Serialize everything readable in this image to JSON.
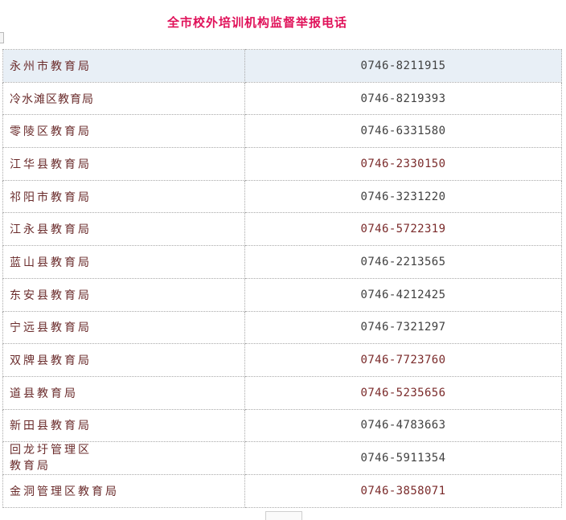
{
  "title": "全市校外培训机构监督举报电话",
  "rows": [
    {
      "unit": "永州市教育局",
      "phone": "0746-8211915"
    },
    {
      "unit": "冷水滩区教育局",
      "phone": "0746-8219393"
    },
    {
      "unit": "零陵区教育局",
      "phone": "0746-6331580"
    },
    {
      "unit": "江华县教育局",
      "phone": "0746-2330150"
    },
    {
      "unit": "祁阳市教育局",
      "phone": "0746-3231220"
    },
    {
      "unit": "江永县教育局",
      "phone": "0746-5722319"
    },
    {
      "unit": "蓝山县教育局",
      "phone": "0746-2213565"
    },
    {
      "unit": "东安县教育局",
      "phone": "0746-4212425"
    },
    {
      "unit": "宁远县教育局",
      "phone": "0746-7321297"
    },
    {
      "unit": "双牌县教育局",
      "phone": "0746-7723760"
    },
    {
      "unit": "道县教育局",
      "phone": "0746-5235656"
    },
    {
      "unit": "新田县教育局",
      "phone": "0746-4783663"
    },
    {
      "unit_line1": "回龙圩管理区",
      "unit_line2": "教育局",
      "phone": "0746-5911354"
    },
    {
      "unit": "金洞管理区教育局",
      "phone": "0746-3858071"
    }
  ]
}
